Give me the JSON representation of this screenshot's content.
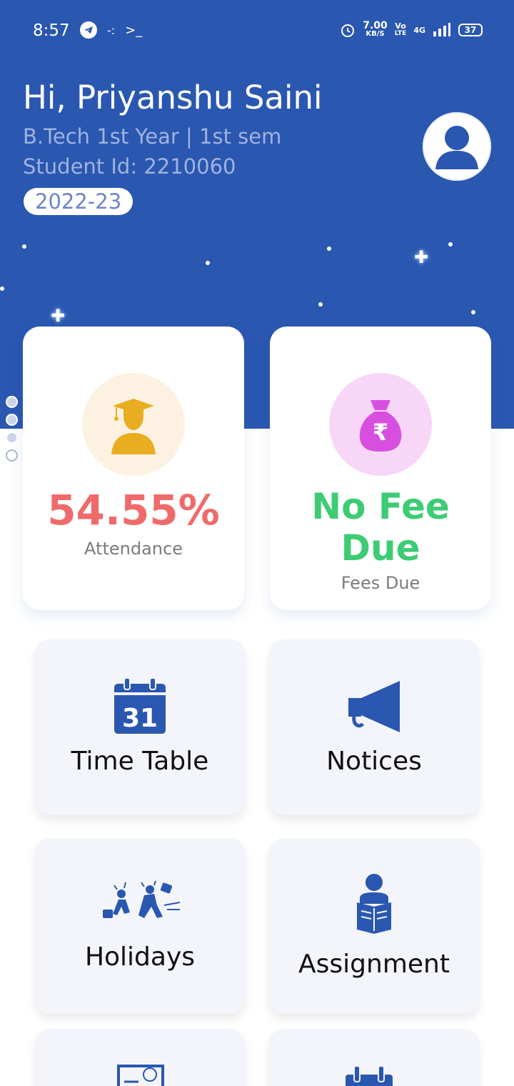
{
  "status": {
    "time": "8:57",
    "net_speed_value": "7.00",
    "net_speed_unit": "KB/S",
    "volte_top": "Vo",
    "volte_bottom": "LTE",
    "network": "4G",
    "battery": "37"
  },
  "profile": {
    "greeting": "Hi, Priyanshu Saini",
    "program": "B.Tech 1st Year | 1st sem",
    "student_id": "Student Id: 2210060",
    "session": "2022-23"
  },
  "stats": {
    "attendance_value": "54.55%",
    "attendance_label": "Attendance",
    "fees_value": "No Fee Due",
    "fees_label": "Fees Due"
  },
  "menu": {
    "items": [
      {
        "label": "Time Table",
        "icon": "calendar-icon"
      },
      {
        "label": "Notices",
        "icon": "megaphone-icon"
      },
      {
        "label": "Holidays",
        "icon": "holidays-icon"
      },
      {
        "label": "Assignment",
        "icon": "reader-icon"
      }
    ]
  },
  "calendar_day": "31",
  "colors": {
    "primary": "#2a57b0",
    "attendance": "#ef6b6b",
    "fees": "#3dcc74",
    "attendance_icon_bg": "#fdf2e2",
    "attendance_icon": "#e9ad22",
    "fees_icon_bg": "#f7d6f8",
    "fees_icon": "#d84fe0",
    "menu_icon": "#2a57b0"
  }
}
